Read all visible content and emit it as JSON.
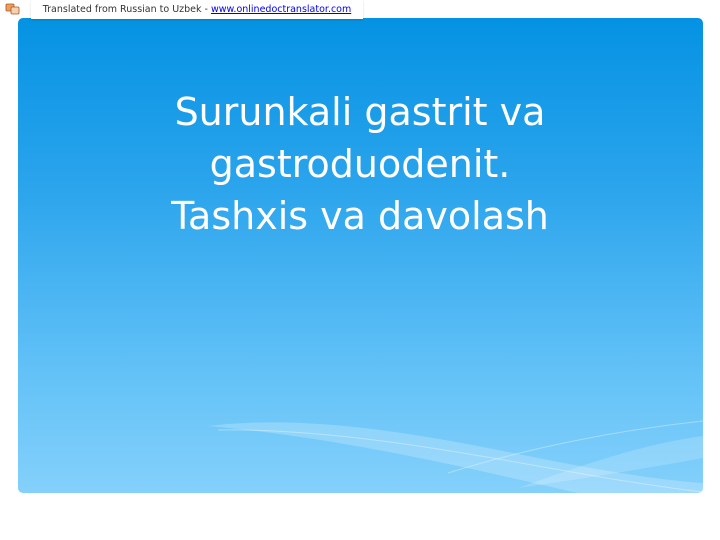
{
  "banner": {
    "text": "Translated from Russian to Uzbek - ",
    "link_text": "www.onlinedoctranslator.com",
    "icon": "translator-logo-icon"
  },
  "slide": {
    "title_lines": [
      "Surunkali gastrit va",
      "gastroduodenit.",
      "Tashxis va davolash"
    ]
  },
  "colors": {
    "slide_top": "#0592e3",
    "slide_bottom": "#84d0fb",
    "title_text": "#ffffff",
    "link": "#0000ee"
  }
}
